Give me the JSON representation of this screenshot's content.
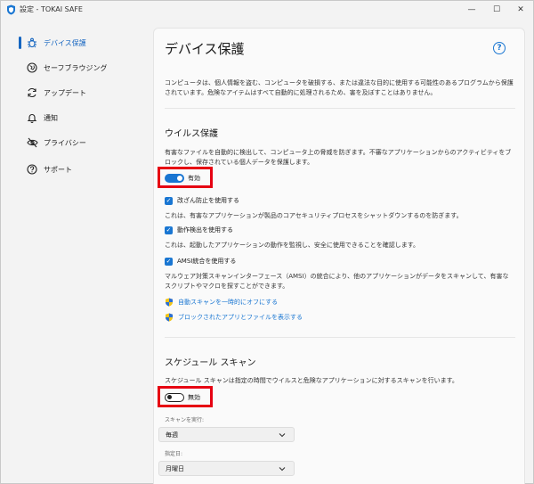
{
  "window": {
    "title": "設定 - TOKAI SAFE",
    "min_glyph": "—",
    "max_glyph": "☐",
    "close_glyph": "✕"
  },
  "sidebar": {
    "items": [
      {
        "label": "デバイス保護",
        "icon": "bug-shield-icon",
        "active": true
      },
      {
        "label": "セーフブラウジング",
        "icon": "globe-icon",
        "active": false
      },
      {
        "label": "アップデート",
        "icon": "refresh-icon",
        "active": false
      },
      {
        "label": "通知",
        "icon": "bell-icon",
        "active": false
      },
      {
        "label": "プライバシー",
        "icon": "eye-off-icon",
        "active": false
      },
      {
        "label": "サポート",
        "icon": "question-icon",
        "active": false
      }
    ]
  },
  "main": {
    "title": "デバイス保護",
    "help_glyph": "?",
    "intro": "コンピュータは、個人情報を盗む、コンピュータを破損する、または違法な目的に使用する可能性のあるプログラムから保護されています。危険なアイテムはすべて自動的に処理されるため、害を及ぼすことはありません。",
    "virus": {
      "title": "ウイルス保護",
      "desc": "有害なファイルを自動的に検出して、コンピュータ上の脅威を防ぎます。不審なアプリケーションからのアクティビティをブロックし、保存されている個人データを保護します。",
      "toggle_label": "有効",
      "toggle_on": true,
      "options": [
        {
          "label": "改ざん防止を使用する",
          "checked": true,
          "desc": "これは、有害なアプリケーションが製品のコアセキュリティプロセスをシャットダウンするのを防ぎます。"
        },
        {
          "label": "動作検出を使用する",
          "checked": true,
          "desc": "これは、起動したアプリケーションの動作を監視し、安全に使用できることを確認します。"
        },
        {
          "label": "AMSI統合を使用する",
          "checked": true,
          "desc": "マルウェア対策スキャンインターフェース（AMSI）の統合により、他のアプリケーションがデータをスキャンして、有害なスクリプトやマクロを探すことができます。"
        }
      ],
      "links": [
        {
          "label": "自動スキャンを一時的にオフにする",
          "icon": "uac-shield-icon"
        },
        {
          "label": "ブロックされたアプリとファイルを表示する",
          "icon": "uac-shield-icon"
        }
      ]
    },
    "schedule": {
      "title": "スケジュール スキャン",
      "desc": "スケジュール スキャンは指定の時間でウイルスと危険なアプリケーションに対するスキャンを行います。",
      "toggle_label": "無効",
      "toggle_on": false,
      "run_label": "スキャンを実行:",
      "run_value": "毎週",
      "day_label": "指定日:",
      "day_value": "月曜日"
    }
  },
  "colors": {
    "accent": "#1976d2",
    "highlight": "#e60012"
  }
}
